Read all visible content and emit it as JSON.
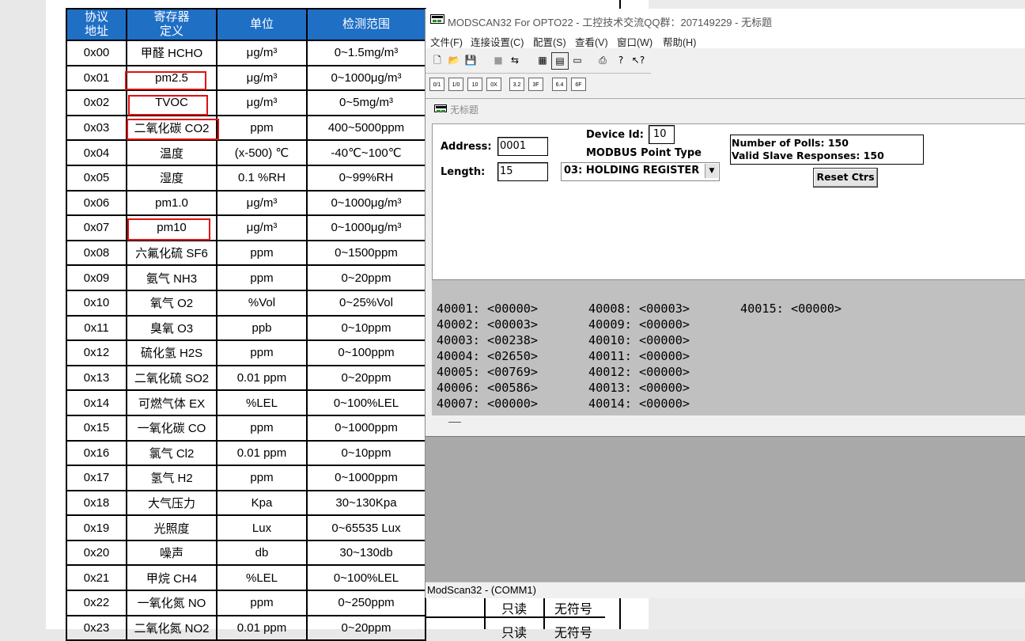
{
  "document": {
    "headers": [
      [
        "协议",
        "地址"
      ],
      [
        "寄存器",
        "定义"
      ],
      [
        "单位"
      ],
      [
        "检测范围"
      ]
    ],
    "rows": [
      [
        "0x00",
        "甲醛 HCHO",
        "μg/m³",
        "0~1.5mg/m³"
      ],
      [
        "0x01",
        "pm2.5",
        "μg/m³",
        "0~1000μg/m³"
      ],
      [
        "0x02",
        "TVOC",
        "μg/m³",
        "0~5mg/m³"
      ],
      [
        "0x03",
        "二氧化碳  CO2",
        "ppm",
        "400~5000ppm"
      ],
      [
        "0x04",
        "温度",
        "(x-500) ℃",
        "-40℃~100℃"
      ],
      [
        "0x05",
        "湿度",
        "0.1 %RH",
        "0~99%RH"
      ],
      [
        "0x06",
        "pm1.0",
        "μg/m³",
        "0~1000μg/m³"
      ],
      [
        "0x07",
        "pm10",
        "μg/m³",
        "0~1000μg/m³"
      ],
      [
        "0x08",
        "六氟化硫  SF6",
        "ppm",
        "0~1500ppm"
      ],
      [
        "0x09",
        "氨气 NH3",
        "ppm",
        "0~20ppm"
      ],
      [
        "0x10",
        "氧气  O2",
        "%Vol",
        "0~25%Vol"
      ],
      [
        "0x11",
        "臭氧  O3",
        "ppb",
        "0~10ppm"
      ],
      [
        "0x12",
        "硫化氢  H2S",
        "ppm",
        "0~100ppm"
      ],
      [
        "0x13",
        "二氧化硫  SO2",
        "0.01 ppm",
        "0~20ppm"
      ],
      [
        "0x14",
        "可燃气体 EX",
        "%LEL",
        "0~100%LEL"
      ],
      [
        "0x15",
        "一氧化碳 CO",
        "ppm",
        "0~1000ppm"
      ],
      [
        "0x16",
        "氯气 Cl2",
        "0.01 ppm",
        "0~10ppm"
      ],
      [
        "0x17",
        "氢气 H2",
        "ppm",
        "0~1000ppm"
      ],
      [
        "0x18",
        "大气压力",
        "Kpa",
        "30~130Kpa"
      ],
      [
        "0x19",
        "光照度",
        "Lux",
        "0~65535 Lux"
      ],
      [
        "0x20",
        "噪声",
        "db",
        "30~130db"
      ],
      [
        "0x21",
        "甲烷  CH4",
        "%LEL",
        "0~100%LEL"
      ],
      [
        "0x22",
        "一氧化氮  NO",
        "ppm",
        "0~250ppm"
      ],
      [
        "0x23",
        "二氧化氮  NO2",
        "0.01 ppm",
        "0~20ppm"
      ]
    ],
    "behind_cells": [
      [
        "只读",
        "无符号"
      ],
      [
        "只读",
        "无符号"
      ]
    ]
  },
  "modscan": {
    "title": "MODSCAN32 For OPTO22 - 工控技术交流QQ群：207149229 - 无标题",
    "menu": [
      "文件(F)",
      "连接设置(C)",
      "配置(S)",
      "查看(V)",
      "窗口(W)",
      "帮助(H)"
    ],
    "child_title": "无标题",
    "address_label": "Address:",
    "address_value": "0001",
    "length_label": "Length:",
    "length_value": "15",
    "device_id_label": "Device Id:",
    "device_id_value": "10",
    "point_type_label": "MODBUS Point Type",
    "point_type_value": "03: HOLDING REGISTER",
    "polls_text": "Number of Polls: 150",
    "responses_text": "Valid Slave Responses: 150",
    "reset_label": "Reset Ctrs",
    "registers_col1": [
      "40001: <00000>",
      "40002: <00003>",
      "40003: <00238>",
      "40004: <02650>",
      "40005: <00769>",
      "40006: <00586>",
      "40007: <00000>"
    ],
    "registers_col2": [
      "40008: <00003>",
      "40009: <00000>",
      "40010: <00000>",
      "40011: <00000>",
      "40012: <00000>",
      "40013: <00000>",
      "40014: <00000>"
    ],
    "registers_col3": [
      "40015: <00000>"
    ],
    "toolbar_small_labels": [
      "0/1",
      "1/0",
      "10",
      "0X",
      "3.2",
      "3F",
      "6.4",
      "6F"
    ],
    "status": "ModScan32 - (COMM1)"
  }
}
